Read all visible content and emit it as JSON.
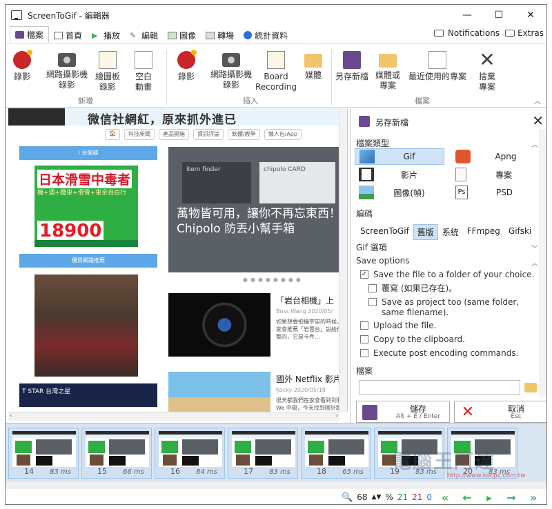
{
  "window": {
    "title": "ScreenToGif - 編輯器"
  },
  "tabs": [
    {
      "label": "檔案",
      "active": true
    },
    {
      "label": "首頁"
    },
    {
      "label": "播放"
    },
    {
      "label": "編輯"
    },
    {
      "label": "圖像"
    },
    {
      "label": "轉場"
    },
    {
      "label": "統計資料"
    }
  ],
  "tabs_right": {
    "notifications": "Notifications",
    "extras": "Extras"
  },
  "ribbon": {
    "new_group": {
      "label": "新增",
      "buttons": [
        "錄影",
        "網路攝影機\n錄影",
        "繪圖板\n錄影",
        "空白\n動畫"
      ]
    },
    "insert_group": {
      "label": "插入",
      "buttons": [
        "錄影",
        "網路攝影機\n錄影",
        "Board\nRecording",
        "媒體"
      ]
    },
    "file_group": {
      "label": "檔案",
      "buttons": [
        "另存新檔",
        "媒體或\n專案",
        "最近使用的專案",
        "捨棄\n專案"
      ]
    }
  },
  "canvas": {
    "banner_text": "微信社網紅，原來抓外進已",
    "nav_items": [
      "🏠",
      "科技新聞",
      "產品開箱",
      "資訊評論",
      "軟體/教學",
      "懶人包/App"
    ],
    "left_bar1": "I 台服務",
    "ad1_title": "日本滑雪中毒者",
    "ad1_sub": "機+酒+纜車+滑雪+東京自由行",
    "ad1_price": "18900",
    "left_bar2": "優質網路推薦",
    "ad3_text": "T STAR 台灣之星",
    "hero_card1": "item finder",
    "hero_card2": "chipolo CARD",
    "hero_title": "萬物皆可用，讓你不再忘東西！ Chipolo 防丟小幫手箱",
    "articles": [
      {
        "title": "「岩台相機」上",
        "meta": "Boss Wang 2020/05/",
        "body": "如果想要拍攝宇宙的時候，大家會推薦「岩雲台」說給你完整的，它是卡件..."
      },
      {
        "title": "國外 Netflix 影片",
        "meta": "Kocky 2020/05/18",
        "body": "很天都我們在家會看到到利用 We 中間，今天找到國外跟 Netflix..."
      }
    ]
  },
  "save_panel": {
    "title": "另存新檔",
    "file_type_label": "檔案類型",
    "file_types": [
      {
        "label": "Gif",
        "selected": true
      },
      {
        "label": "Apng"
      },
      {
        "label": "影片"
      },
      {
        "label": "專案"
      },
      {
        "label": "圖像(幀)"
      },
      {
        "label": "PSD"
      }
    ],
    "encoder_label": "編碼",
    "encoders": [
      {
        "label": "ScreenToGif"
      },
      {
        "label": "舊版",
        "selected": true
      },
      {
        "label": "系統"
      },
      {
        "label": "FFmpeg"
      },
      {
        "label": "Gifski"
      }
    ],
    "gif_options_label": "Gif 選項",
    "save_options_label": "Save options",
    "options": [
      {
        "label": "Save the file to a folder of your choice.",
        "checked": true
      },
      {
        "label": "覆寫 (如果已存在)。",
        "checked": false
      },
      {
        "label": "Save as project too (same folder, same filename).",
        "checked": false
      },
      {
        "label": "Upload the file.",
        "checked": false
      },
      {
        "label": "Copy to the clipboard.",
        "checked": false
      },
      {
        "label": "Execute post encoding commands.",
        "checked": false
      }
    ],
    "file_label": "檔案",
    "file_value": "",
    "save_button": {
      "label": "儲存",
      "shortcut": "Alt + E / Enter"
    },
    "cancel_button": {
      "label": "取消",
      "shortcut": "Esc"
    }
  },
  "frames": [
    {
      "number": "14",
      "duration": "83 ms"
    },
    {
      "number": "15",
      "duration": "66 ms"
    },
    {
      "number": "16",
      "duration": "84 ms"
    },
    {
      "number": "17",
      "duration": "83 ms"
    },
    {
      "number": "18",
      "duration": "65 ms"
    },
    {
      "number": "19",
      "duration": "83 ms"
    },
    {
      "number": "20",
      "duration": "83 ms"
    }
  ],
  "watermark": {
    "text": "電腦王阿達",
    "url": "http://www.kocpc.com.tw"
  },
  "statusbar": {
    "zoom": "68",
    "zoom_unit": "%",
    "count_green": "21",
    "count_red": "21",
    "count_blue": "0"
  },
  "colors": {
    "accent": "#cfe3f7",
    "selected_border": "#9cc3ea",
    "nav_green": "#40b060",
    "record_red": "#c9252b"
  }
}
